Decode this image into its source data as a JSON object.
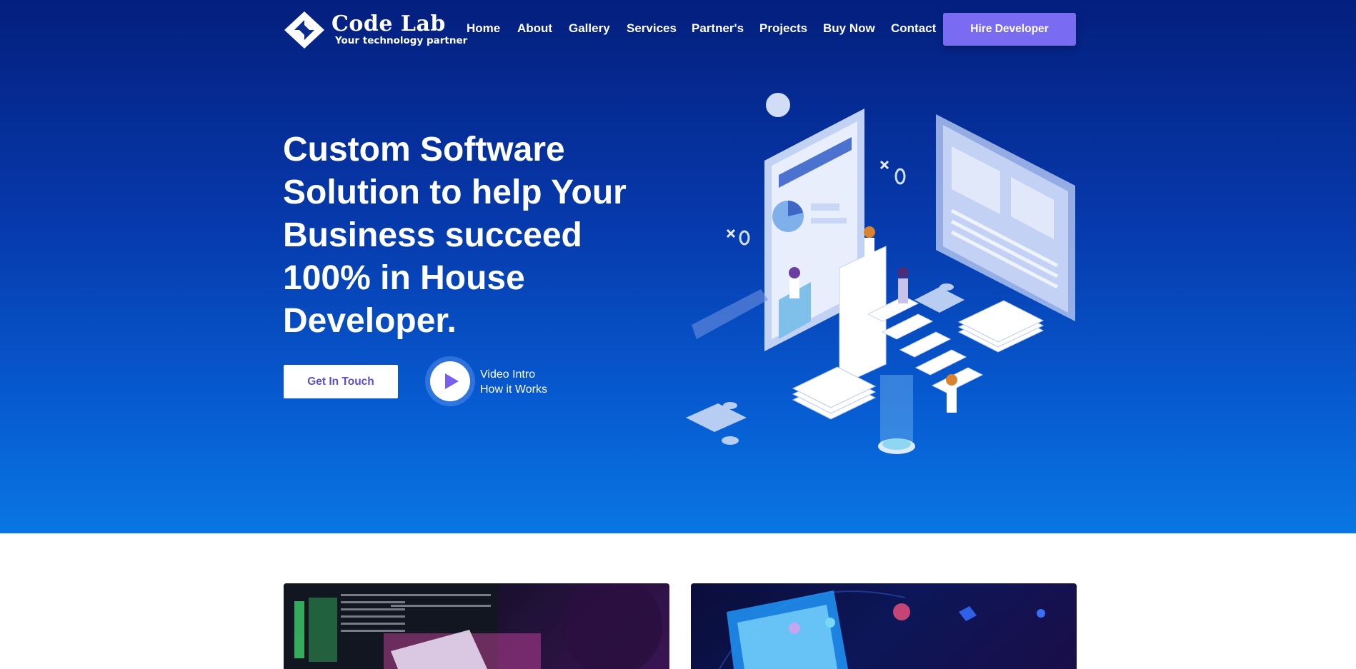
{
  "header": {
    "logo_title": "Code Lab",
    "logo_tagline": "Your technology partner",
    "nav": [
      "Home",
      "About",
      "Gallery",
      "Services",
      "Partner's",
      "Projects",
      "Buy Now",
      "Contact"
    ],
    "hire_button": "Hire Developer"
  },
  "hero": {
    "headline_lines": [
      "Custom Software",
      "Solution to help Your",
      "Business succeed",
      "100% in House",
      "Developer."
    ],
    "cta_button": "Get In Touch",
    "video_line1": "Video Intro",
    "video_line2": "How it Works"
  },
  "colors": {
    "hero_top": "#041f7e",
    "hero_bottom": "#0877e3",
    "accent": "#7a6cf2"
  },
  "icons": [
    "logo-diamond-icon",
    "play-icon"
  ]
}
